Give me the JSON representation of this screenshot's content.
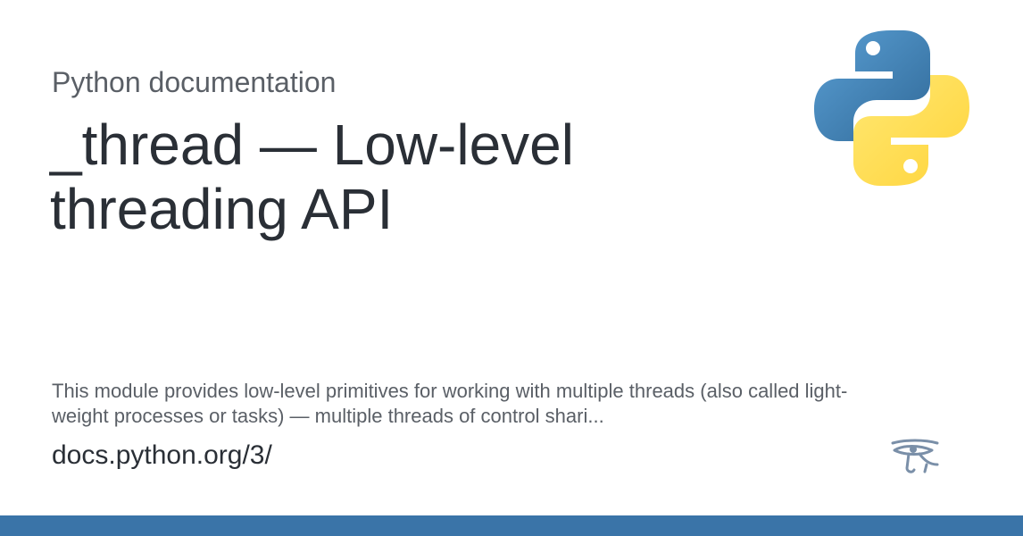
{
  "site": {
    "name": "Python documentation",
    "url": "docs.python.org/3/"
  },
  "page": {
    "title": "_thread — Low-level threading API",
    "description": "This module provides low-level primitives for working with multiple threads (also called light-weight processes or tasks) — multiple threads of control shari..."
  },
  "icons": {
    "logo": "python-logo-icon",
    "eye": "eye-of-horus-icon"
  },
  "colors": {
    "python_blue": "#3a74a8",
    "python_yellow": "#ffd43b",
    "accent_bar": "#3a74a8"
  }
}
